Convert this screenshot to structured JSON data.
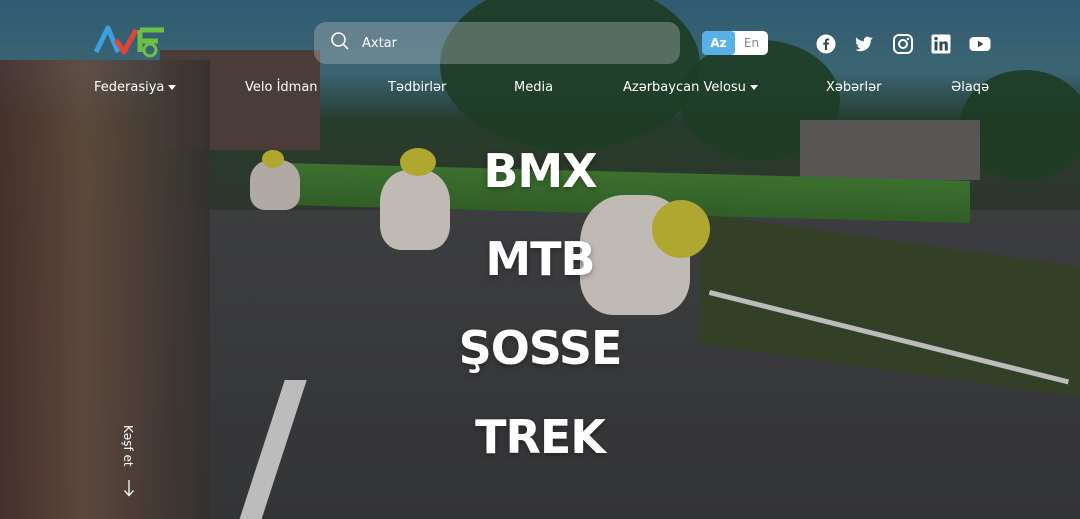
{
  "header": {
    "logo_name": "federation-logo",
    "search": {
      "placeholder": "Axtar"
    },
    "languages": [
      {
        "label": "Az",
        "active": true
      },
      {
        "label": "En",
        "active": false
      }
    ],
    "social": [
      "facebook-icon",
      "twitter-icon",
      "instagram-icon",
      "linkedin-icon",
      "youtube-icon"
    ]
  },
  "nav": [
    {
      "label": "Federasiya",
      "dropdown": true
    },
    {
      "label": "Velo İdman",
      "dropdown": false
    },
    {
      "label": "Tədbirlər",
      "dropdown": false
    },
    {
      "label": "Media",
      "dropdown": false
    },
    {
      "label": "Azərbaycan Velosu",
      "dropdown": true
    },
    {
      "label": "Xəbərlər",
      "dropdown": false
    },
    {
      "label": "Əlaqə",
      "dropdown": false
    }
  ],
  "disciplines": [
    "BMX",
    "MTB",
    "ŞOSSE",
    "TREK"
  ],
  "explore": {
    "label": "Kəşf et"
  },
  "colors": {
    "accent": "#59b0e6",
    "logo_blue": "#3aa0e0",
    "logo_green": "#6cc04a"
  }
}
